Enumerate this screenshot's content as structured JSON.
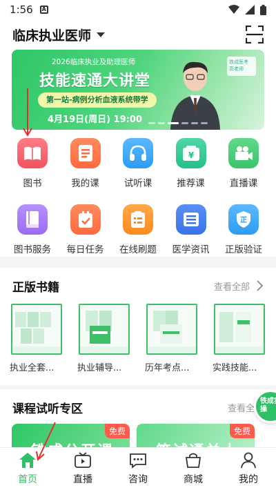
{
  "status_bar": {
    "time": "1:56",
    "sim_label": "A"
  },
  "header": {
    "title": "临床执业医师"
  },
  "banner": {
    "subtitle": "2026临床执业及助理医师",
    "headline": "技能速通大讲堂",
    "pill": "第一站-病例分析血液系统带学",
    "date": "4月19日(周日) 19:00",
    "badge": "铁成医考 高老师"
  },
  "grid_row1": [
    {
      "label": "图书",
      "icon": "book-icon",
      "color": "#f0535f"
    },
    {
      "label": "我的课",
      "icon": "document-icon",
      "color": "#ff6a3d"
    },
    {
      "label": "试听课",
      "icon": "headphones-icon",
      "color": "#2d9cf2"
    },
    {
      "label": "推荐课",
      "icon": "yen-box-icon",
      "color": "#27c08a"
    },
    {
      "label": "直播课",
      "icon": "video-camera-icon",
      "color": "#3cc36b"
    }
  ],
  "grid_row2": [
    {
      "label": "图书服务",
      "icon": "book-service-icon",
      "color": "#9b6cf0"
    },
    {
      "label": "每日任务",
      "icon": "task-check-icon",
      "color": "#ff6a3d"
    },
    {
      "label": "在线刷题",
      "icon": "quiz-list-icon",
      "color": "#ff8a1c"
    },
    {
      "label": "医学资讯",
      "icon": "news-icon",
      "color": "#3a72e8"
    },
    {
      "label": "正版验证",
      "icon": "shield-icon",
      "color": "#2d9cf2"
    }
  ],
  "books_section": {
    "title": "正版书籍",
    "see_all": "查看全部",
    "items": [
      {
        "name": "执业全套..."
      },
      {
        "name": "执业辅导..."
      },
      {
        "name": "历年考点..."
      },
      {
        "name": "实践技能..."
      }
    ]
  },
  "courses_section": {
    "title": "课程试听专区",
    "see_all": "查看全部",
    "items": [
      {
        "title": "铁成公开课",
        "badge": "免费"
      },
      {
        "title": "笔试通关大讲堂",
        "badge": "免费"
      }
    ]
  },
  "floater": {
    "text": "铁成实操"
  },
  "tabbar": [
    {
      "label": "首页",
      "icon": "home-icon",
      "active": true
    },
    {
      "label": "直播",
      "icon": "tv-icon",
      "active": false
    },
    {
      "label": "咨询",
      "icon": "chat-icon",
      "active": false
    },
    {
      "label": "商城",
      "icon": "shopping-bag-icon",
      "active": false
    },
    {
      "label": "我的",
      "icon": "user-icon",
      "active": false
    }
  ],
  "colors": {
    "accent": "#2fbf67",
    "annotation": "#e0302b"
  }
}
